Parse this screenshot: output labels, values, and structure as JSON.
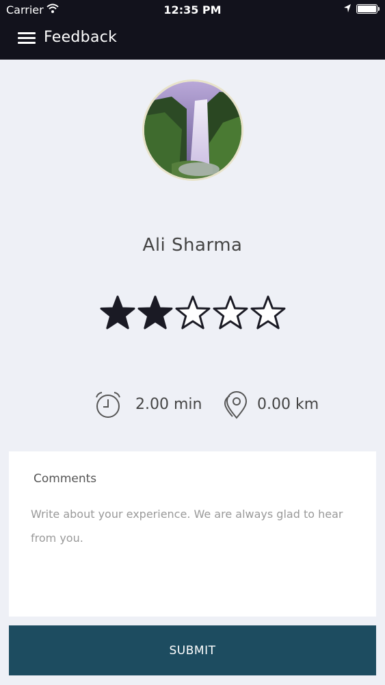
{
  "status_bar": {
    "carrier": "Carrier",
    "time": "12:35 PM"
  },
  "navbar": {
    "title": "Feedback",
    "menu_icon": "hamburger-menu-icon"
  },
  "profile": {
    "name": "Ali Sharma",
    "avatar": "waterfall-photo"
  },
  "rating": {
    "value": 2,
    "max": 5
  },
  "stats": {
    "duration": "2.00 min",
    "duration_icon": "alarm-clock-icon",
    "distance": "0.00 km",
    "distance_icon": "location-pins-icon"
  },
  "comments": {
    "label": "Comments",
    "placeholder": "Write about your experience. We are always glad to hear from you.",
    "value": ""
  },
  "submit": {
    "label": "SUBMIT"
  },
  "colors": {
    "header_bg": "#12121c",
    "page_bg": "#eef0f6",
    "button_bg": "#1d4c60"
  }
}
